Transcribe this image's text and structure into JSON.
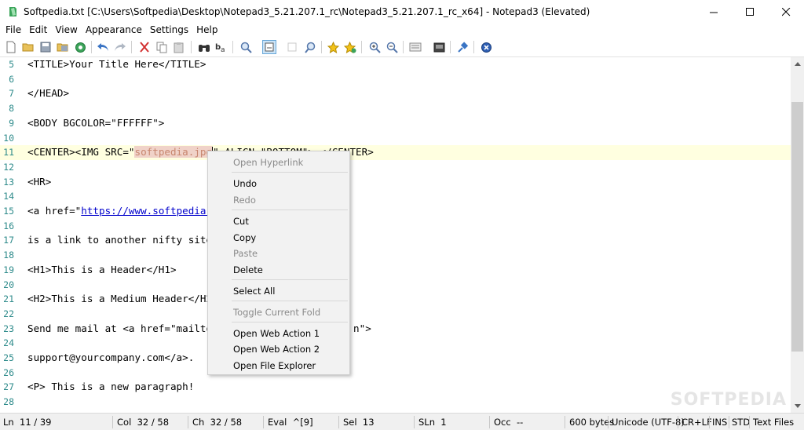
{
  "window": {
    "title": "Softpedia.txt [C:\\Users\\Softpedia\\Desktop\\Notepad3_5.21.207.1_rc\\Notepad3_5.21.207.1_rc_x64] - Notepad3 (Elevated)",
    "app_icon": "notepad3-icon"
  },
  "menu": [
    "File",
    "Edit",
    "View",
    "Appearance",
    "Settings",
    "Help"
  ],
  "toolbar": {
    "buttons": [
      "new-file-icon",
      "open-icon",
      "save-icon",
      "save-as-icon",
      "browse-icon",
      "undo-icon",
      "redo-icon",
      "cut-icon",
      "copy-icon",
      "paste-icon",
      "find-icon",
      "replace-icon",
      "goto-icon",
      "wordwrap-icon",
      "whitespace-icon",
      "zoom-view-icon",
      "favorite-icon",
      "add-favorite-icon",
      "zoom-in-icon",
      "zoom-out-icon",
      "scheme-icon",
      "customize-icon",
      "pin-icon",
      "exit-icon"
    ]
  },
  "editor": {
    "lines": [
      {
        "num": "5",
        "text": "<TITLE>Your Title Here</TITLE>"
      },
      {
        "num": "6",
        "text": ""
      },
      {
        "num": "7",
        "text": "</HEAD>"
      },
      {
        "num": "8",
        "text": ""
      },
      {
        "num": "9",
        "text": "<BODY BGCOLOR=\"FFFFFF\">"
      },
      {
        "num": "10",
        "text": ""
      },
      {
        "num": "11",
        "text_pre": "<CENTER><IMG SRC=\"",
        "text_sel": "softpedia.jpg",
        "text_post": "\" ALIGN=\"BOTTOM\"> </CENTER>"
      },
      {
        "num": "12",
        "text": ""
      },
      {
        "num": "13",
        "text": "<HR>"
      },
      {
        "num": "14",
        "text": ""
      },
      {
        "num": "15",
        "text_pre": "<a href=\"",
        "text_link": "https://www.softpedia."
      },
      {
        "num": "16",
        "text": ""
      },
      {
        "num": "17",
        "text": "is a link to another nifty site"
      },
      {
        "num": "18",
        "text": ""
      },
      {
        "num": "19",
        "text": "<H1>This is a Header</H1>"
      },
      {
        "num": "20",
        "text": ""
      },
      {
        "num": "21",
        "text": "<H2>This is a Medium Header</H2"
      },
      {
        "num": "22",
        "text": ""
      },
      {
        "num": "23",
        "text_pre": "Send me mail at <a href=\"mailto",
        "text_post": "n\">"
      },
      {
        "num": "24",
        "text": ""
      },
      {
        "num": "25",
        "text": "support@yourcompany.com</a>."
      },
      {
        "num": "26",
        "text": ""
      },
      {
        "num": "27",
        "text": "<P> This is a new paragraph!"
      },
      {
        "num": "28",
        "text": ""
      }
    ]
  },
  "context_menu": {
    "items": [
      {
        "label": "Open Hyperlink",
        "enabled": false
      },
      {
        "label": "Undo",
        "enabled": true
      },
      {
        "label": "Redo",
        "enabled": false
      },
      {
        "label": "Cut",
        "enabled": true
      },
      {
        "label": "Copy",
        "enabled": true
      },
      {
        "label": "Paste",
        "enabled": false
      },
      {
        "label": "Delete",
        "enabled": true
      },
      {
        "label": "Select All",
        "enabled": true
      },
      {
        "label": "Toggle Current Fold",
        "enabled": false
      },
      {
        "label": "Open Web Action 1",
        "enabled": true
      },
      {
        "label": "Open Web Action 2",
        "enabled": true
      },
      {
        "label": "Open File Explorer",
        "enabled": true
      }
    ]
  },
  "status": {
    "ln": "Ln  11 / 39",
    "col": "Col  32 / 58",
    "ch": "Ch  32 / 58",
    "eval": "Eval  ^[9]",
    "sel": "Sel  13",
    "sln": "SLn  1",
    "occ": "Occ  --",
    "size": "600 bytes",
    "encoding": "Unicode (UTF-8)",
    "eol": "CR+LF",
    "ins": "INS",
    "std": "STD",
    "lexer": "Text Files"
  },
  "watermark": "SOFTPEDIA"
}
